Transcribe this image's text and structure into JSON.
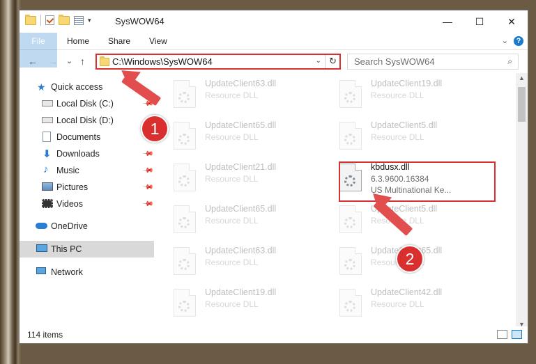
{
  "window": {
    "title": "SysWOW64",
    "controls": {
      "minimize": "—",
      "maximize": "☐",
      "close": "✕"
    }
  },
  "ribbon": {
    "tabs": [
      "File",
      "Home",
      "Share",
      "View"
    ],
    "help": "?"
  },
  "navigation": {
    "back": "←",
    "forward": "→",
    "recent": "⌄",
    "up": "↑",
    "address": "C:\\Windows\\SysWOW64",
    "refresh": "↻",
    "search_placeholder": "Search SysWOW64",
    "search_icon": "⌕"
  },
  "sidebar": {
    "items": [
      {
        "label": "Quick access",
        "icon": "star-icon",
        "pinned": false
      },
      {
        "label": "Local Disk (C:)",
        "icon": "drive-icon",
        "pinned": true
      },
      {
        "label": "Local Disk (D:)",
        "icon": "drive-icon",
        "pinned": false
      },
      {
        "label": "Documents",
        "icon": "documents-icon",
        "pinned": true
      },
      {
        "label": "Downloads",
        "icon": "download-icon",
        "pinned": true
      },
      {
        "label": "Music",
        "icon": "music-icon",
        "pinned": true
      },
      {
        "label": "Pictures",
        "icon": "pictures-icon",
        "pinned": true
      },
      {
        "label": "Videos",
        "icon": "videos-icon",
        "pinned": true
      },
      {
        "label": "OneDrive",
        "icon": "cloud-icon",
        "pinned": false
      },
      {
        "label": "This PC",
        "icon": "computer-icon",
        "pinned": false,
        "selected": true
      },
      {
        "label": "Network",
        "icon": "network-icon",
        "pinned": false
      }
    ]
  },
  "files": [
    {
      "name": "UpdateClient63.dll",
      "line1": "Resource DLL",
      "line2": ""
    },
    {
      "name": "UpdateClient19.dll",
      "line1": "Resource DLL",
      "line2": ""
    },
    {
      "name": "UpdateClient65.dll",
      "line1": "Resource DLL",
      "line2": ""
    },
    {
      "name": "UpdateClient5.dll",
      "line1": "Resource DLL",
      "line2": ""
    },
    {
      "name": "UpdateClient21.dll",
      "line1": "Resource DLL",
      "line2": ""
    },
    {
      "name": "kbdusx.dll",
      "line1": "6.3.9600.16384",
      "line2": "US Multinational Ke...",
      "active": true
    },
    {
      "name": "UpdateClient65.dll",
      "line1": "Resource DLL",
      "line2": ""
    },
    {
      "name": "UpdateClient5.dll",
      "line1": "Resource DLL",
      "line2": ""
    },
    {
      "name": "UpdateClient63.dll",
      "line1": "Resource DLL",
      "line2": ""
    },
    {
      "name": "UpdateClient65.dll",
      "line1": "Resource DLL",
      "line2": ""
    },
    {
      "name": "UpdateClient19.dll",
      "line1": "Resource DLL",
      "line2": ""
    },
    {
      "name": "UpdateClient42.dll",
      "line1": "Resource DLL",
      "line2": ""
    }
  ],
  "status": {
    "item_count": "114 items"
  },
  "annotations": {
    "step1": "1",
    "step2": "2",
    "color": "#d9302f"
  }
}
